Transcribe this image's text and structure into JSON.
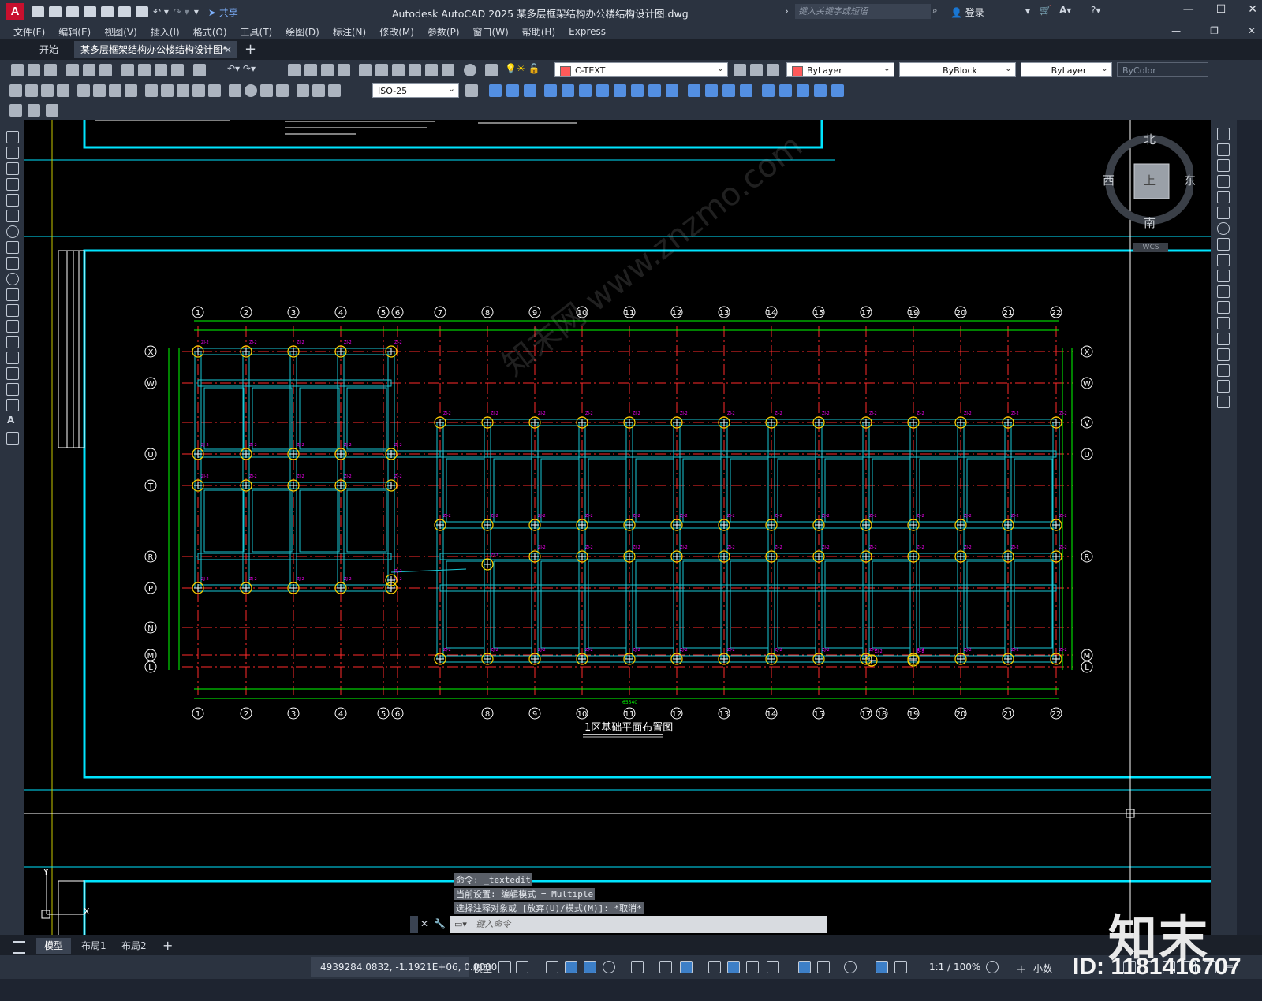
{
  "titlebar": {
    "app_icon_letter": "A",
    "share_label": "共享",
    "window_title": "Autodesk AutoCAD 2025    某多层框架结构办公楼结构设计图.dwg",
    "search_placeholder": "键入关键字或短语",
    "login_label": "登录"
  },
  "menu": [
    "文件(F)",
    "编辑(E)",
    "视图(V)",
    "插入(I)",
    "格式(O)",
    "工具(T)",
    "绘图(D)",
    "标注(N)",
    "修改(M)",
    "参数(P)",
    "窗口(W)",
    "帮助(H)",
    "Express"
  ],
  "tabs": {
    "home": "开始",
    "document": "某多层框架结构办公楼结构设计图*",
    "close": "×",
    "add": "+"
  },
  "toolbar": {
    "text_style": "C-TEXT",
    "layer": "ByLayer",
    "linetype": "ByBlock",
    "lineweight": "ByLayer",
    "plotstyle": "ByColor",
    "dim_style": "ISO-25",
    "layer_color": "#ff5a5a"
  },
  "viewcube": {
    "north": "北",
    "south": "南",
    "west": "西",
    "east": "东",
    "top": "上",
    "wcs": "WCS"
  },
  "drawing": {
    "title": "1区基础平面布置图",
    "grid_top": [
      "1",
      "2",
      "3",
      "4",
      "5",
      "6",
      "7",
      "8",
      "9",
      "10",
      "11",
      "12",
      "13",
      "14",
      "15",
      "17",
      "19",
      "20",
      "21",
      "22"
    ],
    "grid_bottom": [
      "1",
      "2",
      "3",
      "4",
      "5",
      "6",
      "8",
      "9",
      "10",
      "11",
      "12",
      "13",
      "14",
      "15",
      "17",
      "18",
      "19",
      "20",
      "21",
      "22"
    ],
    "rows_left": [
      "X",
      "W",
      "U",
      "T",
      "R",
      "P",
      "N",
      "M",
      "L"
    ],
    "rows_right": [
      "X",
      "W",
      "V",
      "U",
      "R",
      "M",
      "L"
    ],
    "total_dim": "65540",
    "pile_label": "ZJ-2"
  },
  "command": {
    "history": [
      "命令: _textedit",
      "当前设置: 编辑模式 = Multiple",
      "选择注释对象或 [放弃(U)/模式(M)]: *取消*"
    ],
    "placeholder": "键入命令"
  },
  "layout_tabs": {
    "model": "模型",
    "layout1": "布局1",
    "layout2": "布局2",
    "add": "+"
  },
  "status": {
    "coords": "4939284.0832, -1.1921E+06, 0.0000",
    "model": "模型",
    "scale": "1:1 / 100%",
    "units": "小数"
  },
  "watermark": {
    "logo": "知末",
    "id": "ID: 1181416707",
    "site": "知末网 www.znzmo.com"
  },
  "colors": {
    "bg": "#000000",
    "frame": "#00e5ff",
    "axis": "#ff2a2a",
    "dims": "#00ff00",
    "column": "#ffd400",
    "label": "#ff00ff",
    "ui": "#2b3340"
  }
}
